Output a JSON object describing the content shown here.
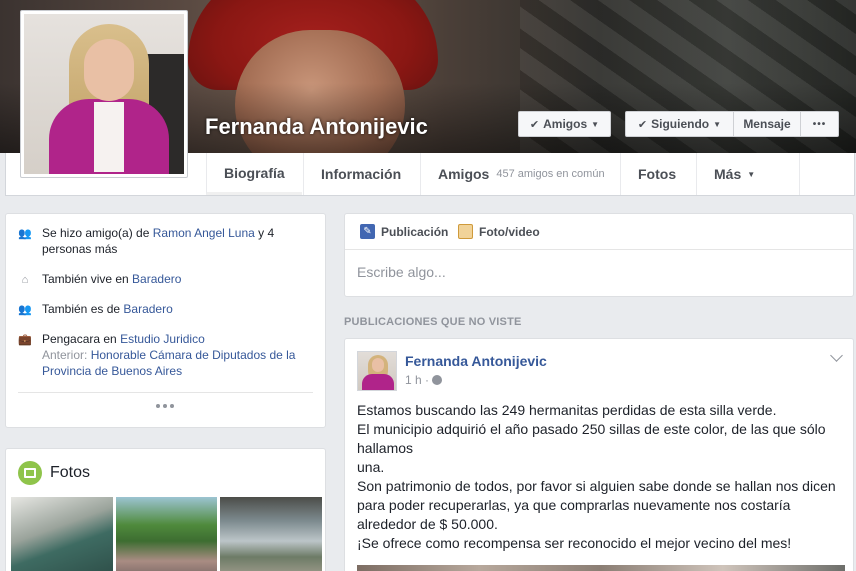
{
  "profile": {
    "name": "Fernanda Antonijevic"
  },
  "actions": {
    "friends_label": "Amigos",
    "following_label": "Siguiendo",
    "message_label": "Mensaje",
    "more_label": "•••"
  },
  "nav": {
    "tabs": [
      {
        "label": "Biografía",
        "active": true
      },
      {
        "label": "Información"
      },
      {
        "label": "Amigos",
        "sub": "457 amigos en común"
      },
      {
        "label": "Fotos"
      },
      {
        "label": "Más"
      }
    ]
  },
  "intro": {
    "friend": {
      "pre": "Se hizo amigo(a) de ",
      "link": "Ramon Angel Luna",
      "post": " y 4 personas más"
    },
    "lives": {
      "pre": "También vive en ",
      "link": "Baradero"
    },
    "from": {
      "pre": "También es de ",
      "link": "Baradero"
    },
    "work": {
      "pre": "Pengacara en ",
      "link": "Estudio Juridico",
      "prev_label": "Anterior: ",
      "prev_link": "Honorable Cámara de Diputados de la Provincia de Buenos Aires"
    }
  },
  "photos": {
    "title": "Fotos"
  },
  "composer": {
    "tab_post": "Publicación",
    "tab_photo": "Foto/video",
    "placeholder": "Escribe algo..."
  },
  "feed": {
    "section_title": "PUBLICACIONES QUE NO VISTE"
  },
  "post": {
    "author": "Fernanda Antonijevic",
    "time": "1 h · ",
    "lines": [
      "Estamos buscando las 249 hermanitas perdidas de esta silla verde.",
      "El municipio adquirió el año pasado 250 sillas de este color, de las que sólo hallamos",
      "una.",
      "Son patrimonio de todos, por favor si alguien sabe donde se hallan nos dicen para poder recuperarlas, ya que comprarlas nuevamente nos costaría alrededor de $ 50.000.",
      "¡Se ofrece como recompensa ser reconocido el mejor vecino del mes!"
    ]
  },
  "colors": {
    "link": "#365899",
    "page_bg": "#e9ebee",
    "accent_photos": "#8fc44b"
  }
}
